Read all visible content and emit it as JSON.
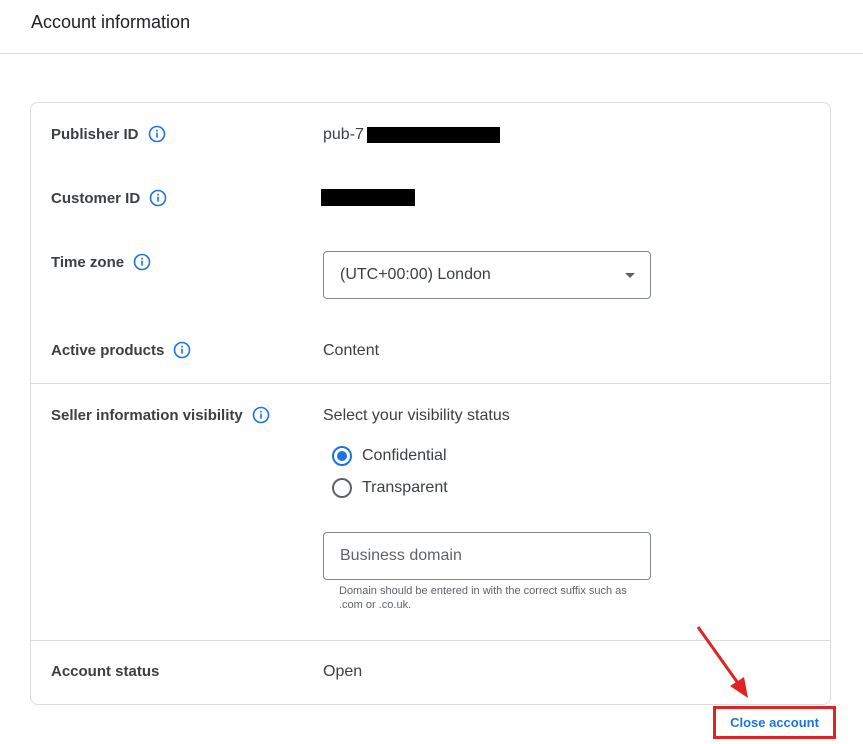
{
  "header": {
    "title": "Account information"
  },
  "rows": {
    "publisher_id": {
      "label": "Publisher ID",
      "value": "pub-7",
      "redacted": true
    },
    "customer_id": {
      "label": "Customer ID",
      "redacted": true
    },
    "time_zone": {
      "label": "Time zone",
      "selected": "(UTC+00:00) London"
    },
    "active_products": {
      "label": "Active products",
      "value": "Content"
    },
    "seller_visibility": {
      "label": "Seller information visibility",
      "prompt": "Select your visibility status",
      "options": [
        {
          "label": "Confidential",
          "checked": true
        },
        {
          "label": "Transparent",
          "checked": false
        }
      ],
      "domain_input": {
        "value": "",
        "placeholder": "Business domain",
        "hint": "Domain should be entered in with the correct suffix such as .com or .co.uk."
      }
    },
    "account_status": {
      "label": "Account status",
      "value": "Open"
    }
  },
  "actions": {
    "close_account": "Close account"
  },
  "annotation": {
    "highlight_color": "#e02424",
    "accent_color": "#1a73e8"
  }
}
